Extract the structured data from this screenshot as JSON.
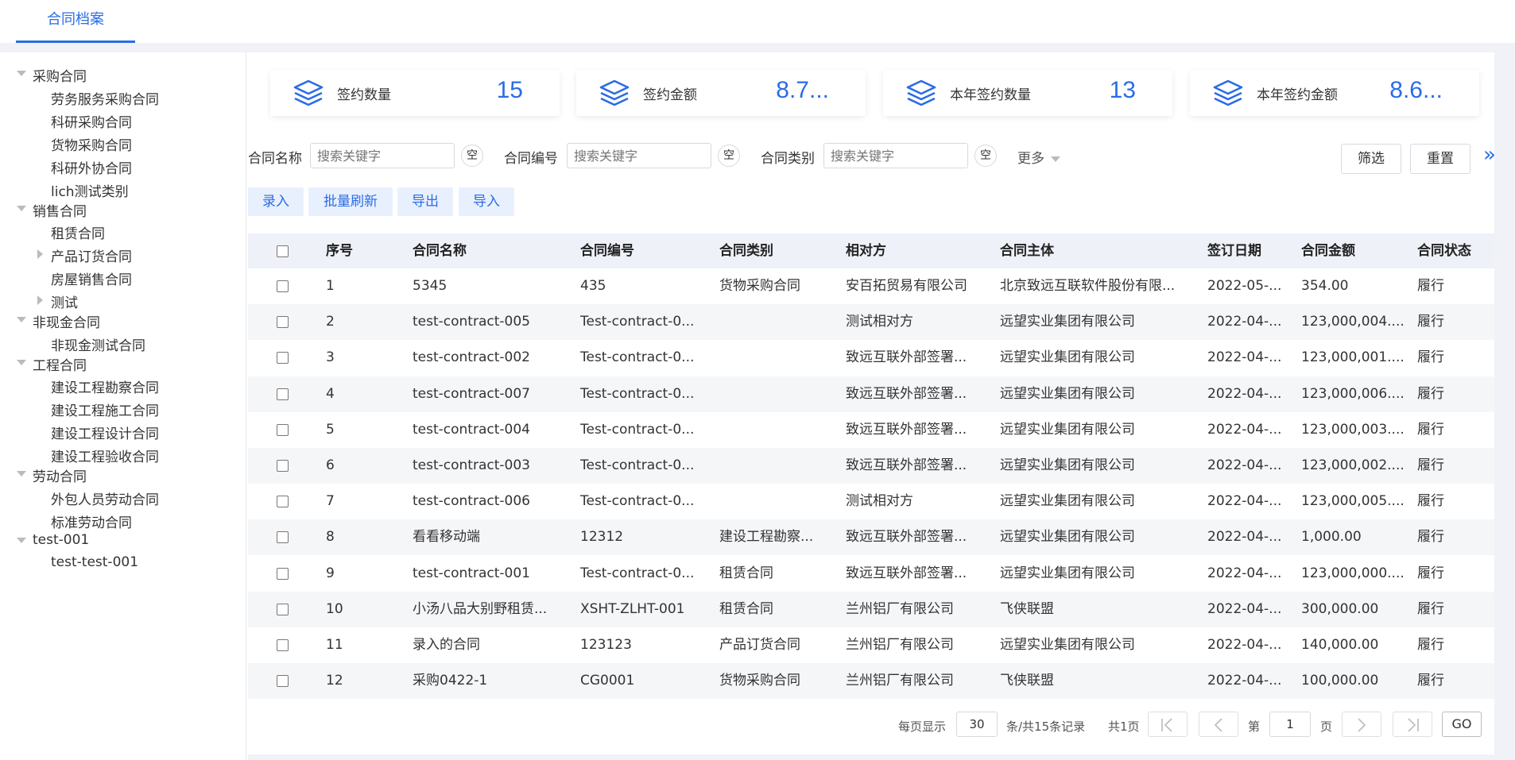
{
  "top_tab": "合同档案",
  "sidebar": {
    "groups": [
      {
        "label": "采购合同",
        "children": [
          "劳务服务采购合同",
          "科研采购合同",
          "货物采购合同",
          "科研外协合同",
          "lich测试类别"
        ]
      },
      {
        "label": "销售合同",
        "children": [
          "租赁合同",
          "产品订货合同",
          "房屋销售合同",
          "测试"
        ]
      },
      {
        "label": "非现金合同",
        "children": [
          "非现金测试合同"
        ]
      },
      {
        "label": "工程合同",
        "children": [
          "建设工程勘察合同",
          "建设工程施工合同",
          "建设工程设计合同",
          "建设工程验收合同"
        ]
      },
      {
        "label": "劳动合同",
        "children": [
          "外包人员劳动合同",
          "标准劳动合同"
        ]
      },
      {
        "label": "test-001",
        "children": [
          "test-test-001"
        ]
      }
    ]
  },
  "stats": [
    {
      "label": "签约数量",
      "value": "15",
      "icon": "layers-icon"
    },
    {
      "label": "签约金额",
      "value": "8.7...",
      "icon": "layers-icon"
    },
    {
      "label": "本年签约数量",
      "value": "13",
      "icon": "layers-icon"
    },
    {
      "label": "本年签约金额",
      "value": "8.6...",
      "icon": "layers-icon"
    }
  ],
  "filters": {
    "name_label": "合同名称",
    "number_label": "合同编号",
    "type_label": "合同类别",
    "placeholder": "搜索关键字",
    "clear_label": "空",
    "more_label": "更多",
    "filter_button": "筛选",
    "reset_button": "重置",
    "expand_icon": "»"
  },
  "actions": [
    "录入",
    "批量刷新",
    "导出",
    "导入"
  ],
  "table": {
    "columns": [
      "序号",
      "合同名称",
      "合同编号",
      "合同类别",
      "相对方",
      "合同主体",
      "签订日期",
      "合同金额",
      "合同状态"
    ],
    "rows": [
      [
        "1",
        "5345",
        "435",
        "货物采购合同",
        "安百拓贸易有限公司",
        "北京致远互联软件股份有限...",
        "2022-05-...",
        "354.00",
        "履行"
      ],
      [
        "2",
        "test-contract-005",
        "Test-contract-0...",
        "",
        "测试相对方",
        "远望实业集团有限公司",
        "2022-04-...",
        "123,000,004....",
        "履行"
      ],
      [
        "3",
        "test-contract-002",
        "Test-contract-0...",
        "",
        "致远互联外部签署...",
        "远望实业集团有限公司",
        "2022-04-...",
        "123,000,001....",
        "履行"
      ],
      [
        "4",
        "test-contract-007",
        "Test-contract-0...",
        "",
        "致远互联外部签署...",
        "远望实业集团有限公司",
        "2022-04-...",
        "123,000,006....",
        "履行"
      ],
      [
        "5",
        "test-contract-004",
        "Test-contract-0...",
        "",
        "致远互联外部签署...",
        "远望实业集团有限公司",
        "2022-04-...",
        "123,000,003....",
        "履行"
      ],
      [
        "6",
        "test-contract-003",
        "Test-contract-0...",
        "",
        "致远互联外部签署...",
        "远望实业集团有限公司",
        "2022-04-...",
        "123,000,002....",
        "履行"
      ],
      [
        "7",
        "test-contract-006",
        "Test-contract-0...",
        "",
        "测试相对方",
        "远望实业集团有限公司",
        "2022-04-...",
        "123,000,005....",
        "履行"
      ],
      [
        "8",
        "看看移动端",
        "12312",
        "建设工程勘察...",
        "致远互联外部签署...",
        "远望实业集团有限公司",
        "2022-04-...",
        "1,000.00",
        "履行"
      ],
      [
        "9",
        "test-contract-001",
        "Test-contract-0...",
        "租赁合同",
        "致远互联外部签署...",
        "远望实业集团有限公司",
        "2022-04-...",
        "123,000,000....",
        "履行"
      ],
      [
        "10",
        "小汤八品大别野租赁...",
        "XSHT-ZLHT-001",
        "租赁合同",
        "兰州铝厂有限公司",
        "飞侠联盟",
        "2022-04-...",
        "300,000.00",
        "履行"
      ],
      [
        "11",
        "录入的合同",
        "123123",
        "产品订货合同",
        "兰州铝厂有限公司",
        "远望实业集团有限公司",
        "2022-04-...",
        "140,000.00",
        "履行"
      ],
      [
        "12",
        "采购0422-1",
        "CG0001",
        "货物采购合同",
        "兰州铝厂有限公司",
        "飞侠联盟",
        "2022-04-...",
        "100,000.00",
        "履行"
      ]
    ]
  },
  "pagination": {
    "per_page_label": "每页显示",
    "per_page_value": "30",
    "records_label": "条/共15条记录",
    "pages_label": "共1页",
    "page_prefix": "第",
    "page_value": "1",
    "page_suffix": "页",
    "go_label": "GO"
  },
  "colors": {
    "accent": "#2a6ce7",
    "header_bg": "#eef1f8",
    "button_bg": "#e9f0fd"
  }
}
